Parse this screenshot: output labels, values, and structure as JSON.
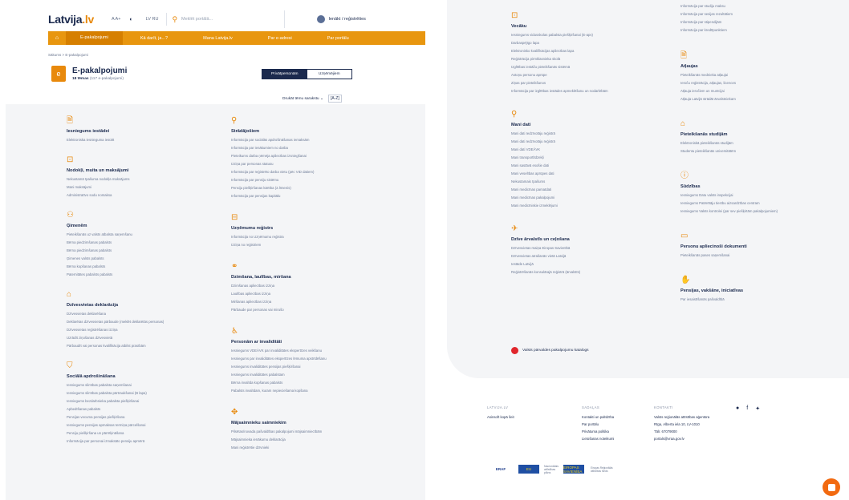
{
  "header": {
    "logo_main": "Latvija",
    "logo_suffix": ".lv",
    "font_size_ctrl": "A A+",
    "contrast_icon": "contrast-icon",
    "lang": "LV  RU",
    "search_placeholder": "Meklēt portālā...",
    "login_label": "Ienākt / reģistrēties"
  },
  "nav": {
    "home_icon": "home-icon",
    "items": [
      "E-pakalpojumi",
      "Kā darīt, ja...?",
      "Mana Latvija.lv",
      "Par e-adresi",
      "Par portālu"
    ]
  },
  "breadcrumb": "Sākums  >  E-pakalpojumi",
  "page": {
    "title": "E-pakalpojumi",
    "topics_count": "18 tēmas",
    "services_count": "(117 e-pakalpojumi)",
    "seg_private": "Privātpersonām",
    "seg_business": "Uzņēmējiem",
    "sort_label": "Drukāt tēmu sarakstu",
    "sort_ab": "[A-Z]"
  },
  "left_col1": [
    {
      "icon": "document-icon",
      "title": "Iesniegums iestādei",
      "items": [
        "Elektroniska iesnieguma iesūtīt"
      ]
    },
    {
      "icon": "money-icon",
      "title": "Nodokļi, muita un maksājumi",
      "items": [
        "Nekustamā īpašuma nodokļa maksājums",
        "Mani maksājumi",
        "Administratīvo sodu nomaksa"
      ]
    },
    {
      "icon": "family-icon",
      "title": "Ģimenēm",
      "items": [
        "Pieteikšanās uz valsts atbalsta saņemšanu",
        "Bērna piedzimšanas pabalsts",
        "Bērna piedzimšanas pabalsts",
        "Ģimenes valsts pabalsts",
        "Bērna kopšanas pabalsts",
        "Paternitātes pabalsts pabalsts"
      ]
    },
    {
      "icon": "house-icon",
      "title": "Dzīvesvietas deklarācija",
      "items": [
        "Dzīvesvietas deklarēšana",
        "Deklarētas dzīvesvietas pārbaude (meklēt deklarētās personas)",
        "Dzīvesvietas reģistrēšanas izziņa",
        "Uzrādīt ziņošanas dzīvesvietā",
        "Pārbaudīt vai personas kvalifikācija atbilst prasībām"
      ]
    },
    {
      "icon": "shield-icon",
      "title": "Sociālā apdrošināšana",
      "items": [
        "Iesniegums slimības pabalsta saņemšanai",
        "Iesniegums slimības pabalsta pārtraukšanai (B lapa)",
        "Iesniegums bezdarbnieka pabalsta piešķiršanai",
        "Apbedīšanas pabalsts",
        "Pensijas vecuma pensijas piešķiršana",
        "Iesniegums pensijas apmaksas termiņa pārcelšanai",
        "Pensiju piešķiršana un pārrēķināšana",
        "Informācija par personai izmaksāto pensiju apmērā"
      ]
    }
  ],
  "left_col2": [
    {
      "icon": "worker-icon",
      "title": "Strādājošiem",
      "items": [
        "Informācija par sociālās apdrošināšanas iemaksām",
        "Informācija par ienākumiem no darba",
        "Pieteikums darba ņēmēja apliecības izsniegšanai",
        "Izziņa par personas statusu",
        "Informācija par reģistrēto darba vietu (pēc VID datiem)",
        "Informācija par pensiju sistēmu",
        "Pensiju piešķiršanas kārtība (2.līmenis)",
        "Informācija par pensijas kapitālu"
      ]
    },
    {
      "icon": "briefcase-icon",
      "title": "Uzņēmumu reģistrs",
      "items": [
        "Informācija no Uzņēmumu reģistra",
        "Izziņa no reģistriem"
      ]
    },
    {
      "icon": "rings-icon",
      "title": "Dzimšana, laulības, miršana",
      "items": [
        "Dzimšanas apliecības izziņa",
        "Laulības apliecības izziņa",
        "Miršanas apliecības izziņa",
        "Pārbaude par personas vai mirušo"
      ]
    },
    {
      "icon": "wheelchair-icon",
      "title": "Personām ar invaliditāti",
      "items": [
        "Iesniegums VDEĀVK par invaliditātes ekspertīzes veikšanu",
        "Iesniegums par invaliditātes ekspertīzes lēmuma apstrīdēšanu",
        "Iesniegums invaliditātes pensijas piešķiršanai",
        "Iesniegums invaliditātes pabalstam",
        "Bērna invalīda kopšanas pabalsts",
        "Pabalsts invalīdam, kuram nepieciešama kopšana"
      ]
    },
    {
      "icon": "handshake-icon",
      "title": "Mājsaimnieku saimniekim",
      "items": [
        "Pilsētas/novada pašvaldības pakalpojumi mājsaimniecībām",
        "Mājsaimnieka ienākumu deklarācija",
        "Mani reģistrētie dzīvnieki"
      ]
    }
  ],
  "right_col1": [
    {
      "icon": "school-icon",
      "title": "Vecāku",
      "items": [
        "Iesniegums vidusskolas pabalsta piešķiršanai (E-apv)",
        "Darbaspējīgo lapa",
        "Elektronisko kvalifikācijas apliecības lapa",
        "Reģistrācija pirmklasnieka skolā",
        "Izglītības iestāžu pieteikšanās sistēmā",
        "Astoņu personu aprūpe",
        "Ziņas par pieteikšanos",
        "Informācija par izglītības iestādes apmeklēšanu un nodarbībām"
      ]
    },
    {
      "icon": "search-person-icon",
      "title": "Mani dati",
      "items": [
        "Mani dati Iedzīvotāju reģistrā",
        "Mani dati Iedzīvotāju reģistrā",
        "Mani dati VDEĀVK",
        "Mani transportlīdzekļi",
        "Mani sastāvā esošie dati",
        "Mani veselības aprūpes dati",
        "Nekustamais īpašums",
        "Mani medicīnas pamatdati",
        "Mani medicīnas pakalpojumi",
        "Mani medicīniskie izmeklējumi"
      ]
    },
    {
      "icon": "plane-icon",
      "title": "Dzīve ārvalstīs un ceļošana",
      "items": [
        "Dzīvesvietas maiņa Eiropas Savienībā",
        "Dzīvesvietas atrašanās vietā Latvijā",
        "Iestāde Latvijā",
        "Reģistrēšanās konsulārajā reģistrā (ārvalstīs)"
      ]
    }
  ],
  "right_col2_top": [
    "Informācija par studiju maksu",
    "Informācija par sesijas rezultātiem",
    "Informācija par stipendijām",
    "Informācija par kredītpunktiem"
  ],
  "right_col2": [
    {
      "icon": "document-icon",
      "title": "Atļaujas",
      "items": [
        "Pieteikšanās mednieka atļaujai",
        "Ieroču reģistrācija, atļaujas, licences",
        "Atļauja ieročiem un munīcijai",
        "Atļauja Latvijā strādāt ārvalstniekam"
      ]
    },
    {
      "icon": "graduation-icon",
      "title": "Pieteikšanās studijām",
      "items": [
        "Elektroniskā pieteikšanās studijām",
        "Studentu pieteikšanās universitātēm"
      ]
    },
    {
      "icon": "warning-icon",
      "title": "Sūdzības",
      "items": [
        "Iesniegums Datu valsts inspekcijai",
        "Iesniegums Patērētāju tiesību aizsardzības centram",
        "Iesniegums Valsts kontrolei (par sev piešķirtām pakalpojumiem)"
      ]
    },
    {
      "icon": "id-card-icon",
      "title": "Personu apliecinoši dokumenti",
      "items": [
        "Pieteikšanās pases saņemšanai"
      ]
    },
    {
      "icon": "hands-icon",
      "title": "Pensijas, vakšāne, iniciatīvas",
      "items": [
        "Par iesaistīšanās pašvaldībā"
      ]
    }
  ],
  "catalog_link": "Valsts pārvaldes pakalpojumu katalogs",
  "footer": {
    "col1_head": "LATVIJA.LV",
    "col1_items": [
      "Asinsoft kopā šeit"
    ],
    "col2_head": "SADAĻAS",
    "col2_items": [
      "Kontakti un palīdzība",
      "Par portālu",
      "Privātuma politika",
      "Lietošanas noteikumi"
    ],
    "col3_head": "KONTAKTI",
    "col3_items": [
      "Valsts reģionālās attīstības aģentūra",
      "Rīga, Alberta iela 10, LV-1010",
      "Tālr. 67079000",
      "portals@vraa.gov.lv"
    ],
    "social": [
      "f-icon",
      "facebook-icon",
      "twitter-icon"
    ],
    "logos": [
      "ERAF",
      "EU",
      "Nacionālais attīstības plāns",
      "EIROPAS SAVIENĪBA",
      "Eiropas Reģionālās attīstības fonds"
    ]
  },
  "chat_icon": "chat-icon",
  "colors": {
    "accent": "#e8960f",
    "navy": "#1b2a4e",
    "grey_bg": "#f4f5f7",
    "chat": "#f26a10"
  }
}
